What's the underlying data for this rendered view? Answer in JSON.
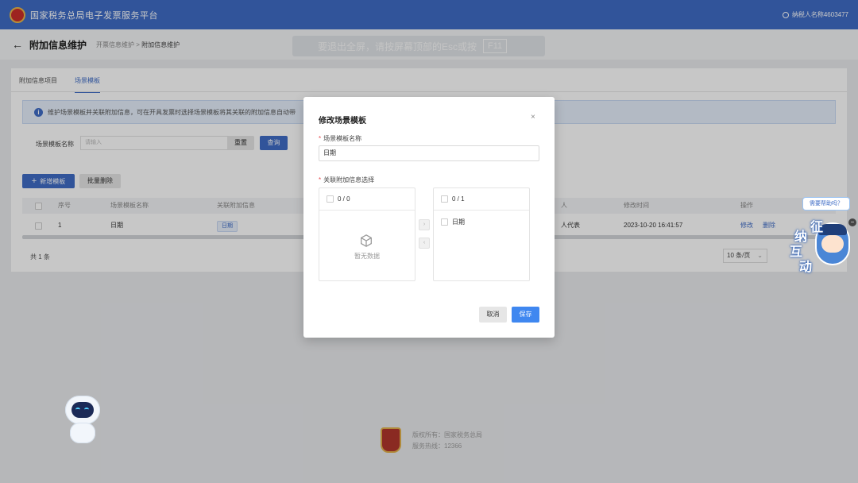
{
  "app": {
    "title": "国家税务总局电子发票服务平台",
    "user": "纳税人名称4603477"
  },
  "page": {
    "title": "附加信息维护",
    "breadcrumb": [
      "开票信息维护",
      "附加信息维护"
    ],
    "breadcrumb_sep": ">",
    "esc_hint": "要退出全屏，请按屏幕顶部的Esc或按",
    "esc_key": "F11"
  },
  "tabs": [
    {
      "label": "附加信息项目",
      "active": false
    },
    {
      "label": "场景模板",
      "active": true
    }
  ],
  "alert": "维护场景模板并关联附加信息，可在开具发票时选择场景模板将其关联的附加信息自动带",
  "search": {
    "label": "场景模板名称",
    "placeholder": "请输入",
    "reset": "重置",
    "query": "查询"
  },
  "toolbar": {
    "add": "新增模板",
    "batch_delete": "批量删除"
  },
  "table": {
    "columns": [
      "序号",
      "场景模板名称",
      "关联附加信息",
      "人",
      "修改时间",
      "操作"
    ],
    "rows": [
      {
        "index": "1",
        "name": "日期",
        "tag": "日期",
        "person": "人代表",
        "modified": "2023-10-20 16:41:57",
        "edit": "修改",
        "delete": "删除"
      }
    ]
  },
  "pagination": {
    "total": "共 1 条",
    "page_size": "10 条/页"
  },
  "modal": {
    "title": "修改场景模板",
    "close": "×",
    "name_label": "场景模板名称",
    "name_value": "日期",
    "assoc_label": "关联附加信息选择",
    "left_count": "0 / 0",
    "empty_text": "暂无数据",
    "right_count": "0 / 1",
    "right_items": [
      "日期"
    ],
    "cancel": "取消",
    "save": "保存"
  },
  "footer": {
    "line1": "版权所有：国家税务总局",
    "line2": "服务热线：12366"
  },
  "helper": {
    "bubble": "需要帮助吗？",
    "chars": [
      "征",
      "纳",
      "互",
      "动"
    ]
  },
  "colors": {
    "primary": "#3f6cc6",
    "save": "#3f87f0",
    "required": "#e5484d"
  }
}
